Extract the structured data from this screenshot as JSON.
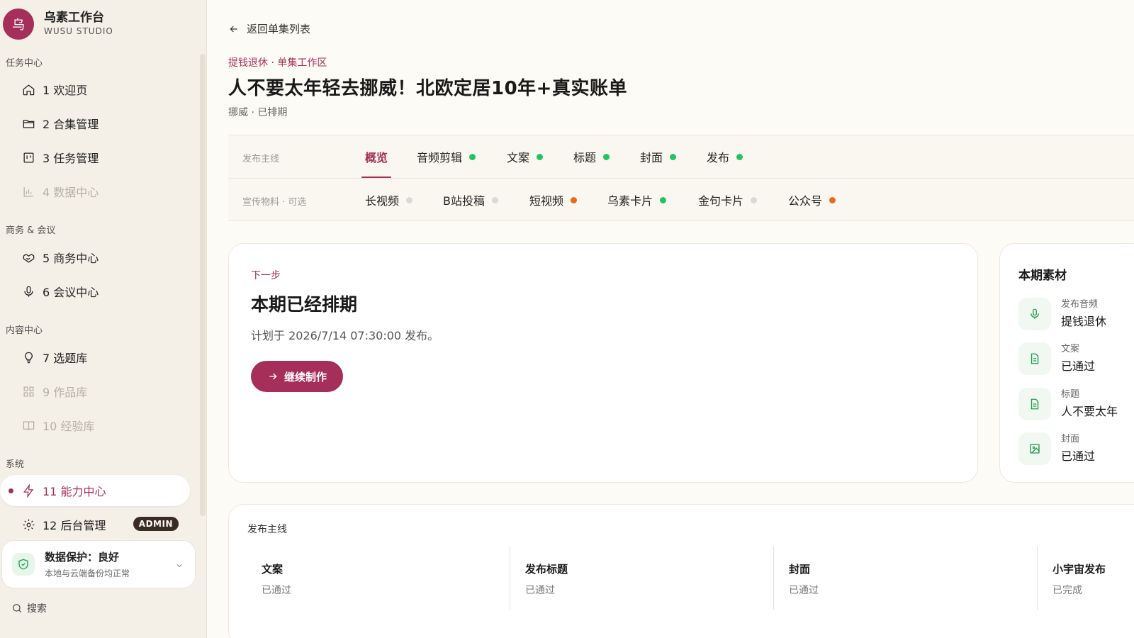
{
  "brand": {
    "logo_char": "乌",
    "name": "乌素工作台",
    "sub": "WUSU STUDIO"
  },
  "sidebar": {
    "groups": [
      {
        "title": "任务中心"
      },
      {
        "title": "商务 & 会议"
      },
      {
        "title": "内容中心"
      },
      {
        "title": "系统"
      }
    ],
    "items": [
      {
        "label": "1 欢迎页",
        "icon": "home-icon"
      },
      {
        "label": "2 合集管理",
        "icon": "folder-icon"
      },
      {
        "label": "3 任务管理",
        "icon": "kanban-icon"
      },
      {
        "label": "4 数据中心",
        "icon": "bar-chart-icon"
      },
      {
        "label": "5 商务中心",
        "icon": "handshake-icon"
      },
      {
        "label": "6 会议中心",
        "icon": "mic-icon"
      },
      {
        "label": "7 选题库",
        "icon": "lightbulb-icon"
      },
      {
        "label": "9 作品库",
        "icon": "grid-icon"
      },
      {
        "label": "10 经验库",
        "icon": "book-icon"
      },
      {
        "label": "11 能力中心",
        "icon": "bolt-icon"
      },
      {
        "label": "12 后台管理",
        "icon": "gear-icon"
      }
    ],
    "admin_badge": "ADMIN",
    "protect": {
      "title": "数据保护：良好",
      "sub": "本地与云端备份均正常"
    },
    "search_label": "搜索"
  },
  "header": {
    "back_label": "返回单集列表",
    "breadcrumb": "提钱退休 · 单集工作区",
    "title": "人不要太年轻去挪威！北欧定居10年+真实账单",
    "subtitle": "挪威 · 已排期"
  },
  "tabs": {
    "main_label": "发布主线",
    "main": [
      {
        "label": "概览",
        "status": "none"
      },
      {
        "label": "音频剪辑",
        "status": "done"
      },
      {
        "label": "文案",
        "status": "done"
      },
      {
        "label": "标题",
        "status": "done"
      },
      {
        "label": "封面",
        "status": "done"
      },
      {
        "label": "发布",
        "status": "done"
      }
    ],
    "promo_label": "宣传物料 · 可选",
    "promo": [
      {
        "label": "长视频",
        "status": "idle"
      },
      {
        "label": "B站投稿",
        "status": "idle"
      },
      {
        "label": "短视频",
        "status": "warn"
      },
      {
        "label": "乌素卡片",
        "status": "done"
      },
      {
        "label": "金句卡片",
        "status": "idle"
      },
      {
        "label": "公众号",
        "status": "warn"
      }
    ]
  },
  "status_colors": {
    "done": "#22c55e",
    "idle": "#d9d9d9",
    "warn": "#ea6a1a",
    "accent": "#a52f59"
  },
  "next_step": {
    "label": "下一步",
    "title": "本期已经排期",
    "desc": "计划于 2026/7/14 07:30:00 发布。",
    "cta": "继续制作"
  },
  "materials": {
    "title": "本期素材",
    "items": [
      {
        "label": "发布音频",
        "value": "提钱退休",
        "icon": "mic-icon"
      },
      {
        "label": "文案",
        "value": "已通过",
        "icon": "document-icon"
      },
      {
        "label": "标题",
        "value": "人不要太年",
        "icon": "document-icon"
      },
      {
        "label": "封面",
        "value": "已通过",
        "icon": "image-icon"
      }
    ]
  },
  "publish": {
    "title": "发布主线",
    "columns": [
      {
        "name": "文案",
        "status": "已通过"
      },
      {
        "name": "发布标题",
        "status": "已通过"
      },
      {
        "name": "封面",
        "status": "已通过"
      },
      {
        "name": "小宇宙发布",
        "status": "已完成"
      }
    ]
  }
}
